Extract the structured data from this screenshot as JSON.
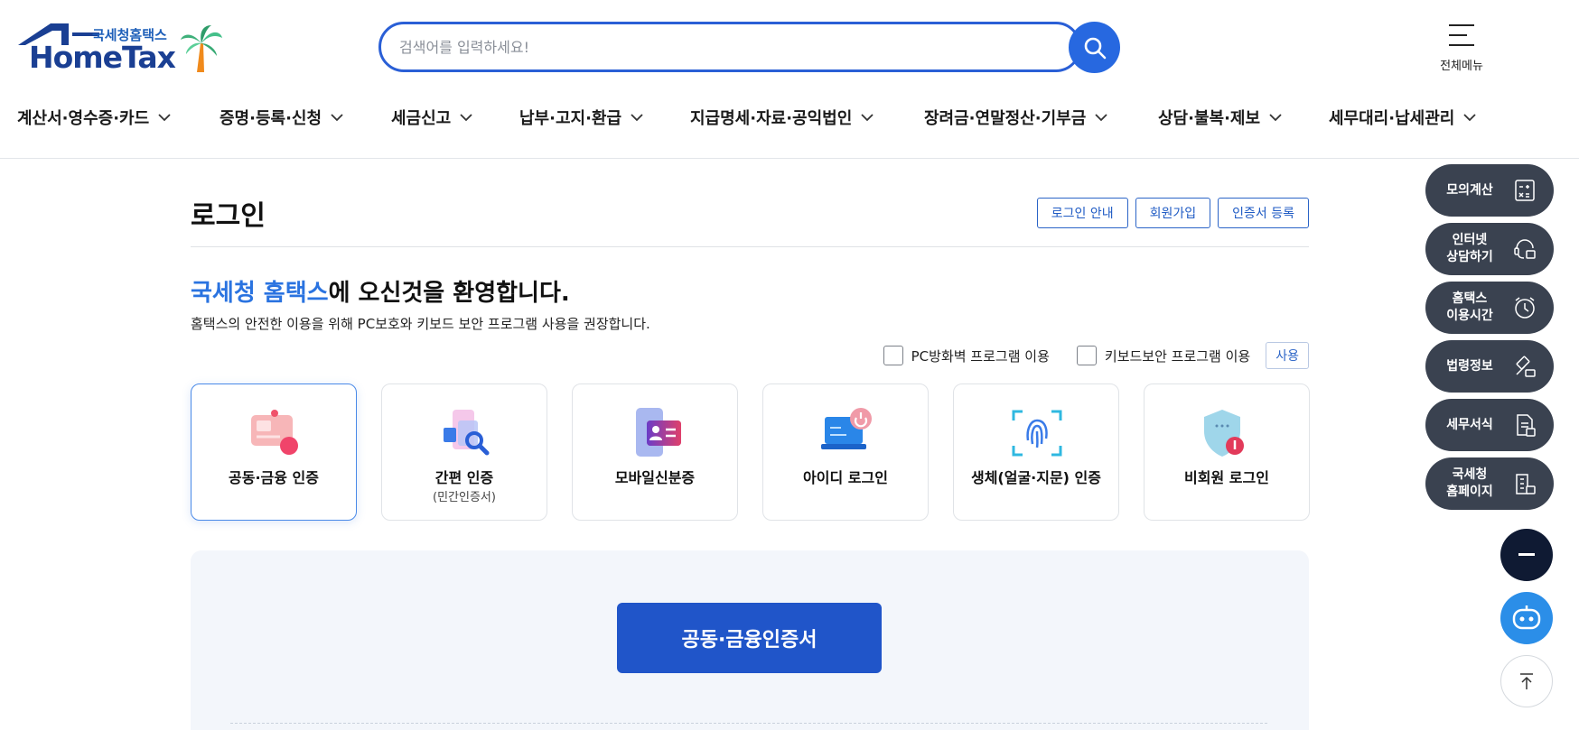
{
  "header": {
    "logo_kr": "국세청홈택스",
    "logo_en": "HomeTax",
    "search_placeholder": "검색어를 입력하세요!",
    "all_menu_label": "전체메뉴"
  },
  "gnb": [
    {
      "label": "계산서·영수증·카드"
    },
    {
      "label": "증명·등록·신청"
    },
    {
      "label": "세금신고"
    },
    {
      "label": "납부·고지·환급"
    },
    {
      "label": "지급명세·자료·공익법인"
    },
    {
      "label": "장려금·연말정산·기부금"
    },
    {
      "label": "상담·불복·제보"
    },
    {
      "label": "세무대리·납세관리"
    }
  ],
  "main": {
    "title": "로그인",
    "links": [
      "로그인 안내",
      "회원가입",
      "인증서 등록"
    ],
    "welcome_accent": "국세청 홈택스",
    "welcome_rest": "에 오신것을 환영합니다.",
    "welcome_sub": "홈택스의 안전한 이용을 위해 PC보호와 키보드 보안 프로그램 사용을 권장합니다.",
    "option_firewall": "PC방화벽 프로그램 이용",
    "option_keyboard": "키보드보안 프로그램 이용",
    "use_label": "사용"
  },
  "login_methods": [
    {
      "label": "공동·금융 인증",
      "sub": "",
      "active": true,
      "icon": "card-certificate-icon"
    },
    {
      "label": "간편 인증",
      "sub": "(민간인증서)",
      "active": false,
      "icon": "simple-auth-icon"
    },
    {
      "label": "모바일신분증",
      "sub": "",
      "active": false,
      "icon": "mobile-id-icon"
    },
    {
      "label": "아이디 로그인",
      "sub": "",
      "active": false,
      "icon": "laptop-power-icon"
    },
    {
      "label": "생체(얼굴·지문) 인증",
      "sub": "",
      "active": false,
      "icon": "fingerprint-icon"
    },
    {
      "label": "비회원 로그인",
      "sub": "",
      "active": false,
      "icon": "shield-icon"
    }
  ],
  "panel": {
    "cert_button": "공동·금융인증서"
  },
  "quick": [
    {
      "label": "모의계산",
      "icon": "calculator-icon"
    },
    {
      "label": "인터넷\n상담하기",
      "icon": "chat-icon"
    },
    {
      "label": "홈택스\n이용시간",
      "icon": "clock-icon"
    },
    {
      "label": "법령정보",
      "icon": "gavel-icon"
    },
    {
      "label": "세무서식",
      "icon": "document-icon"
    },
    {
      "label": "국세청\n홈페이지",
      "icon": "building-icon"
    }
  ],
  "colors": {
    "brand": "#1a3f93",
    "accent": "#2a73e0",
    "primary_button": "#2055c9",
    "quick_bg": "#3a4250"
  }
}
